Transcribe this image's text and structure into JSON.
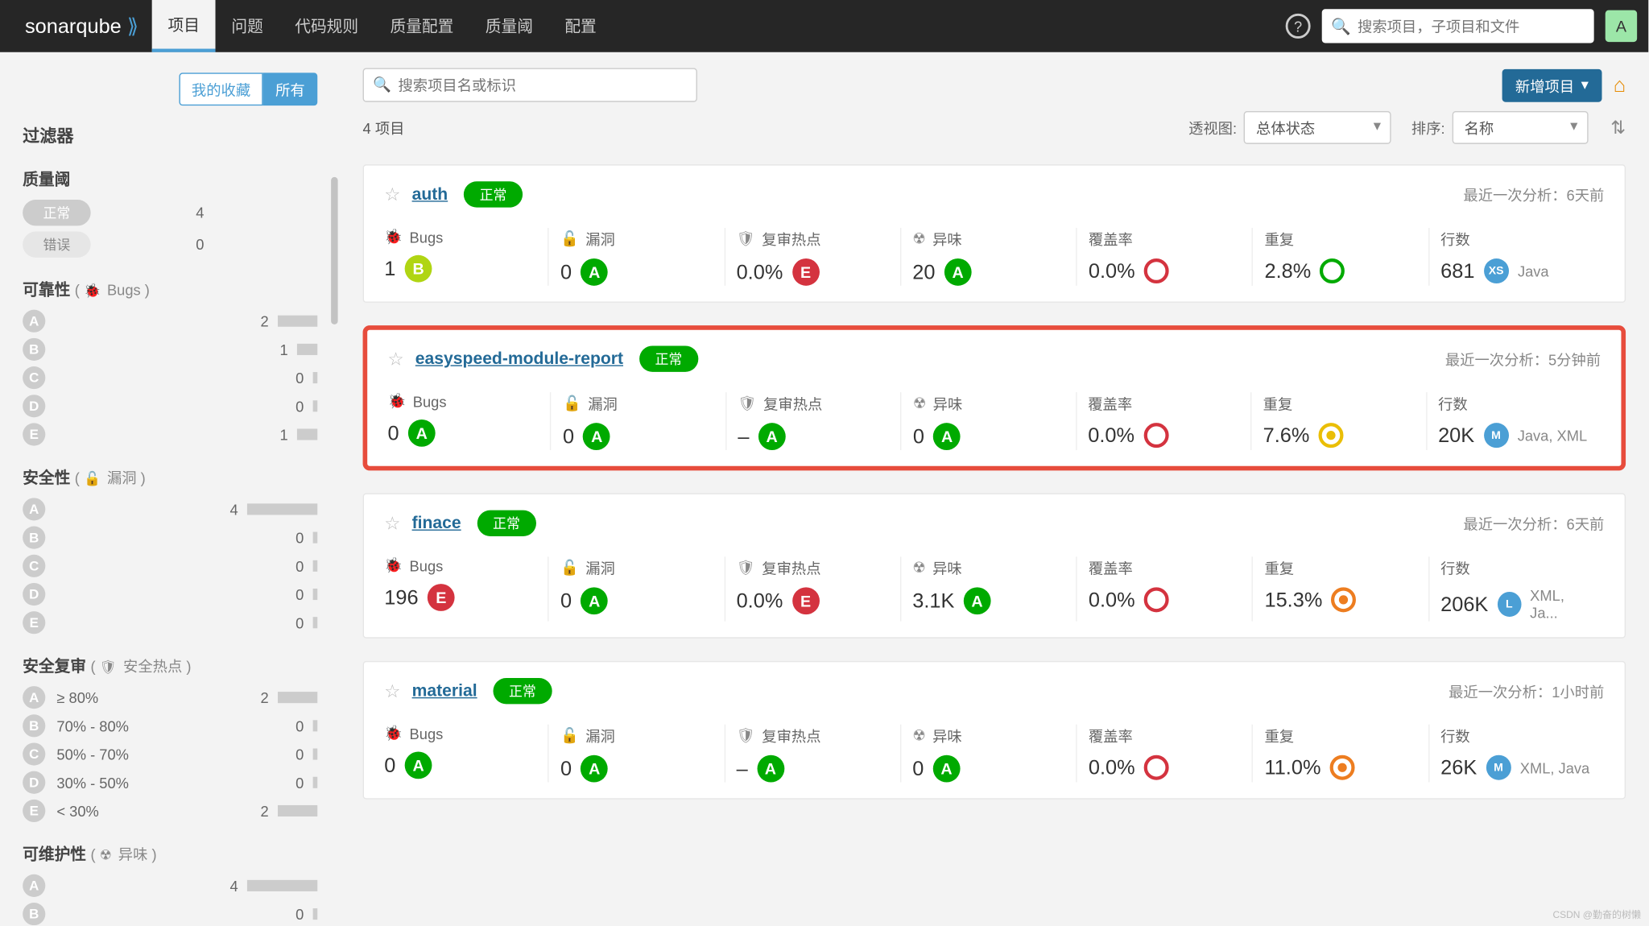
{
  "nav": {
    "logo1": "sonar",
    "logo2": "qube",
    "items": [
      "项目",
      "问题",
      "代码规则",
      "质量配置",
      "质量阈",
      "配置"
    ],
    "search_placeholder": "搜索项目，子项目和文件",
    "avatar": "A"
  },
  "sidebar": {
    "tabs": {
      "fav": "我的收藏",
      "all": "所有"
    },
    "filter_title": "过滤器",
    "qgate": {
      "title": "质量阈",
      "rows": [
        {
          "label": "正常",
          "count": 4,
          "barClass": "w4"
        },
        {
          "label": "错误",
          "count": 0,
          "barClass": "w0"
        }
      ]
    },
    "reliability": {
      "title": "可靠性",
      "sub": "Bugs",
      "rows": [
        {
          "g": "A",
          "count": 2,
          "barClass": "w2"
        },
        {
          "g": "B",
          "count": 1,
          "barClass": "w1"
        },
        {
          "g": "C",
          "count": 0,
          "barClass": "w0"
        },
        {
          "g": "D",
          "count": 0,
          "barClass": "w0"
        },
        {
          "g": "E",
          "count": 1,
          "barClass": "w1"
        }
      ]
    },
    "security": {
      "title": "安全性",
      "sub": "漏洞",
      "rows": [
        {
          "g": "A",
          "count": 4,
          "barClass": "w4"
        },
        {
          "g": "B",
          "count": 0,
          "barClass": "w0"
        },
        {
          "g": "C",
          "count": 0,
          "barClass": "w0"
        },
        {
          "g": "D",
          "count": 0,
          "barClass": "w0"
        },
        {
          "g": "E",
          "count": 0,
          "barClass": "w0"
        }
      ]
    },
    "review": {
      "title": "安全复审",
      "sub": "安全热点",
      "rows": [
        {
          "g": "A",
          "lab": "≥ 80%",
          "count": 2,
          "barClass": "w2"
        },
        {
          "g": "B",
          "lab": "70% - 80%",
          "count": 0,
          "barClass": "w0"
        },
        {
          "g": "C",
          "lab": "50% - 70%",
          "count": 0,
          "barClass": "w0"
        },
        {
          "g": "D",
          "lab": "30% - 50%",
          "count": 0,
          "barClass": "w0"
        },
        {
          "g": "E",
          "lab": "< 30%",
          "count": 2,
          "barClass": "w2"
        }
      ]
    },
    "maint": {
      "title": "可维护性",
      "sub": "异味",
      "rows": [
        {
          "g": "A",
          "count": 4,
          "barClass": "w4"
        },
        {
          "g": "B",
          "count": 0,
          "barClass": "w0"
        }
      ]
    }
  },
  "main": {
    "proj_search_placeholder": "搜索项目名或标识",
    "new_project": "新增项目",
    "count_text": "4 项目",
    "view_label": "透视图:",
    "view_value": "总体状态",
    "sort_label": "排序:",
    "sort_value": "名称",
    "last_label": "最近一次分析：",
    "metric_labels": {
      "bugs": "Bugs",
      "vuln": "漏洞",
      "hotspot": "复审热点",
      "smell": "异味",
      "coverage": "覆盖率",
      "dup": "重复",
      "lines": "行数"
    },
    "status_ok": "正常",
    "projects": [
      {
        "name": "auth",
        "last": "6天前",
        "highlight": false,
        "bugs": {
          "v": "1",
          "r": "B"
        },
        "vuln": {
          "v": "0",
          "r": "A"
        },
        "hotspot": {
          "v": "0.0%",
          "r": "E"
        },
        "smell": {
          "v": "20",
          "r": "A"
        },
        "coverage": {
          "v": "0.0%",
          "c": "red"
        },
        "dup": {
          "v": "2.8%",
          "c": "green"
        },
        "lines": {
          "v": "681",
          "s": "XS",
          "lang": "Java"
        }
      },
      {
        "name": "easyspeed-module-report",
        "last": "5分钟前",
        "highlight": true,
        "bugs": {
          "v": "0",
          "r": "A"
        },
        "vuln": {
          "v": "0",
          "r": "A"
        },
        "hotspot": {
          "v": "–",
          "r": "A"
        },
        "smell": {
          "v": "0",
          "r": "A"
        },
        "coverage": {
          "v": "0.0%",
          "c": "red"
        },
        "dup": {
          "v": "7.6%",
          "c": "yellow"
        },
        "lines": {
          "v": "20K",
          "s": "M",
          "lang": "Java, XML"
        }
      },
      {
        "name": "finace",
        "last": "6天前",
        "highlight": false,
        "bugs": {
          "v": "196",
          "r": "E"
        },
        "vuln": {
          "v": "0",
          "r": "A"
        },
        "hotspot": {
          "v": "0.0%",
          "r": "E"
        },
        "smell": {
          "v": "3.1K",
          "r": "A"
        },
        "coverage": {
          "v": "0.0%",
          "c": "red"
        },
        "dup": {
          "v": "15.3%",
          "c": "orange"
        },
        "lines": {
          "v": "206K",
          "s": "L",
          "lang": "XML, Ja..."
        }
      },
      {
        "name": "material",
        "last": "1小时前",
        "highlight": false,
        "bugs": {
          "v": "0",
          "r": "A"
        },
        "vuln": {
          "v": "0",
          "r": "A"
        },
        "hotspot": {
          "v": "–",
          "r": "A"
        },
        "smell": {
          "v": "0",
          "r": "A"
        },
        "coverage": {
          "v": "0.0%",
          "c": "red"
        },
        "dup": {
          "v": "11.0%",
          "c": "orange"
        },
        "lines": {
          "v": "26K",
          "s": "M",
          "lang": "XML, Java"
        }
      }
    ]
  },
  "watermark": "CSDN @勤奋的树懒"
}
